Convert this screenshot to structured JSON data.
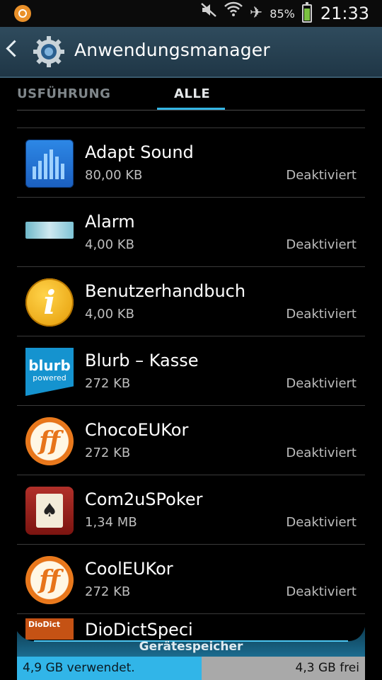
{
  "status_bar": {
    "battery_percent": "85%",
    "battery_level": 0.85,
    "time": "21:33",
    "left_icon": "notification-app-icon",
    "icons": [
      "mute-icon",
      "wifi-icon",
      "airplane-mode-icon",
      "battery-icon"
    ]
  },
  "action_bar": {
    "title": "Anwendungsmanager",
    "back_icon": "chevron-left-icon",
    "app_icon": "gear-icon"
  },
  "tabs": {
    "items": [
      "USFÜHRUNG",
      "ALLE"
    ],
    "selected": "ALLE",
    "accent_color": "#33b5e5"
  },
  "apps": [
    {
      "name": "Adapt Sound",
      "size": "80,00 KB",
      "status": "Deaktiviert",
      "icon": "equalizer-icon"
    },
    {
      "name": "Alarm",
      "size": "4,00 KB",
      "status": "Deaktiviert",
      "icon": "alarm-icon"
    },
    {
      "name": "Benutzerhandbuch",
      "size": "4,00 KB",
      "status": "Deaktiviert",
      "icon": "info-icon"
    },
    {
      "name": "Blurb – Kasse",
      "size": "272 KB",
      "status": "Deaktiviert",
      "icon": "blurb-icon",
      "icon_text": "blurb",
      "icon_subtext": "powered"
    },
    {
      "name": "ChocoEUKor",
      "size": "272 KB",
      "status": "Deaktiviert",
      "icon": "ff-logo-icon",
      "icon_text": "ff"
    },
    {
      "name": "Com2uSPoker",
      "size": "1,34 MB",
      "status": "Deaktiviert",
      "icon": "poker-card-icon"
    },
    {
      "name": "CoolEUKor",
      "size": "272 KB",
      "status": "Deaktiviert",
      "icon": "ff-logo-icon",
      "icon_text": "ff"
    }
  ],
  "partial_app": {
    "name": "DioDictSpeci",
    "icon_text": "DioDict"
  },
  "storage": {
    "label": "Gerätespeicher",
    "used": "4,9 GB verwendet.",
    "free": "4,3 GB frei",
    "used_fraction": 0.53,
    "used_color": "#31b5e8",
    "free_color": "#a9a9a9"
  }
}
